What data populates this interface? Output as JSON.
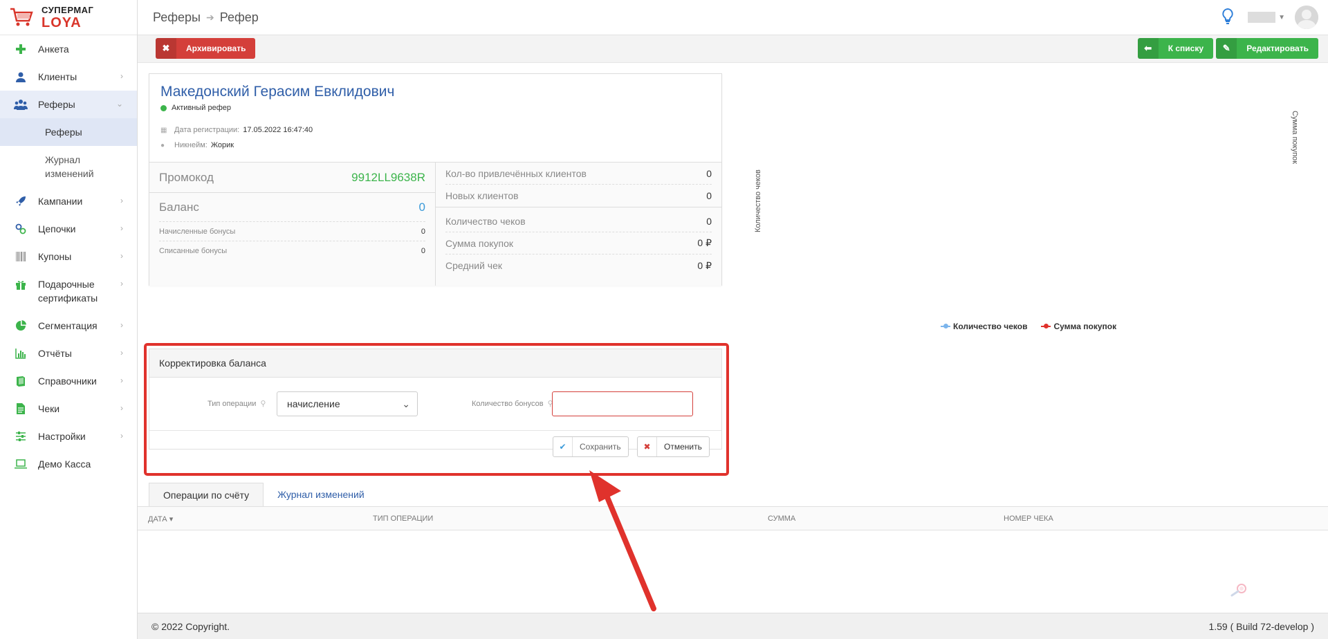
{
  "logo": {
    "line1": "СУПЕРМАГ",
    "line2": "LOYA"
  },
  "colors": {
    "accent_red": "#d43f3a",
    "accent_green": "#3cb44b",
    "link_blue": "#2f5ea8",
    "highlight": "#e0322c"
  },
  "sidebar": {
    "items": [
      {
        "label": "Анкета",
        "icon": "plus-icon"
      },
      {
        "label": "Клиенты",
        "icon": "user-icon"
      },
      {
        "label": "Реферы",
        "icon": "users-icon"
      },
      {
        "label": "Кампании",
        "icon": "rocket-icon"
      },
      {
        "label": "Цепочки",
        "icon": "chain-icon"
      },
      {
        "label": "Купоны",
        "icon": "barcode-icon"
      },
      {
        "label": "Подарочные сертификаты",
        "icon": "gift-icon"
      },
      {
        "label": "Сегментация",
        "icon": "pie-icon"
      },
      {
        "label": "Отчёты",
        "icon": "bar-chart-icon"
      },
      {
        "label": "Справочники",
        "icon": "book-icon"
      },
      {
        "label": "Чеки",
        "icon": "receipt-icon"
      },
      {
        "label": "Настройки",
        "icon": "sliders-icon"
      },
      {
        "label": "Демо Касса",
        "icon": "laptop-icon"
      }
    ],
    "sub": [
      {
        "label": "Реферы"
      },
      {
        "label": "Журнал изменений"
      }
    ]
  },
  "header": {
    "crumb1": "Реферы",
    "crumb2": "Рефер"
  },
  "toolbar": {
    "archive": "Архивировать",
    "to_list": "К списку",
    "edit": "Редактировать"
  },
  "referrer": {
    "name": "Македонский Герасим Евклидович",
    "status": "Активный рефер",
    "reg_label": "Дата регистрации:",
    "reg_value": "17.05.2022 16:47:40",
    "nick_label": "Никнейм:",
    "nick_value": "Жорик",
    "promo_label": "Промокод",
    "promo_value": "9912LL9638R",
    "balance_label": "Баланс",
    "balance_value": "0",
    "accrued_label": "Начисленные бонусы",
    "accrued_value": "0",
    "spent_label": "Списанные бонусы",
    "spent_value": "0"
  },
  "stats": {
    "attracted_label": "Кол-во привлечённых клиентов",
    "attracted_value": "0",
    "new_label": "Новых клиентов",
    "new_value": "0",
    "checks_label": "Количество чеков",
    "checks_value": "0",
    "sum_label": "Сумма покупок",
    "sum_value": "0 ₽",
    "avg_label": "Средний чек",
    "avg_value": "0 ₽"
  },
  "chart": {
    "y_left": "Количество чеков",
    "y_right": "Сумма покупок",
    "legend1": "Количество чеков",
    "legend2": "Сумма покупок",
    "color1": "#7cb5ec",
    "color2": "#e0322c"
  },
  "adjust": {
    "title": "Корректировка баланса",
    "op_label": "Тип операции",
    "op_value": "начисление",
    "qty_label": "Количество бонусов",
    "qty_value": "",
    "save": "Сохранить",
    "cancel": "Отменить"
  },
  "tabs": [
    {
      "label": "Операции по счёту"
    },
    {
      "label": "Журнал изменений"
    }
  ],
  "table": {
    "columns": [
      "ДАТА",
      "ТИП ОПЕРАЦИИ",
      "СУММА",
      "НОМЕР ЧЕКА"
    ]
  },
  "footer": {
    "copyright": "© 2022 Copyright.",
    "version": "1.59 ( Build 72-develop )"
  }
}
